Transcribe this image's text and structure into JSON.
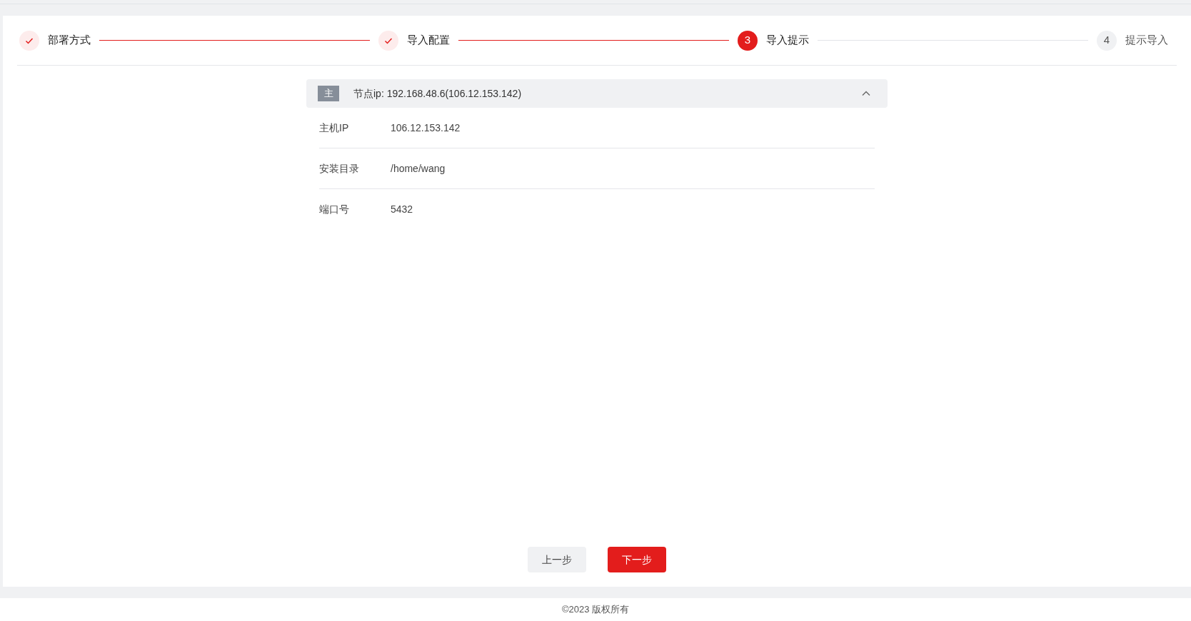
{
  "steps": [
    {
      "label": "部署方式",
      "kind": "done"
    },
    {
      "label": "导入配置",
      "kind": "done"
    },
    {
      "number": "3",
      "label": "导入提示",
      "kind": "active"
    },
    {
      "number": "4",
      "label": "提示导入",
      "kind": "wait"
    }
  ],
  "node": {
    "tag": "主",
    "title": "节点ip: 192.168.48.6(106.12.153.142)",
    "expanded": true,
    "rows": [
      {
        "label": "主机IP",
        "value": "106.12.153.142"
      },
      {
        "label": "安装目录",
        "value": "/home/wang"
      },
      {
        "label": "端口号",
        "value": "5432"
      }
    ]
  },
  "buttons": {
    "prev": "上一步",
    "next": "下一步"
  },
  "footer": "©2023 版权所有"
}
